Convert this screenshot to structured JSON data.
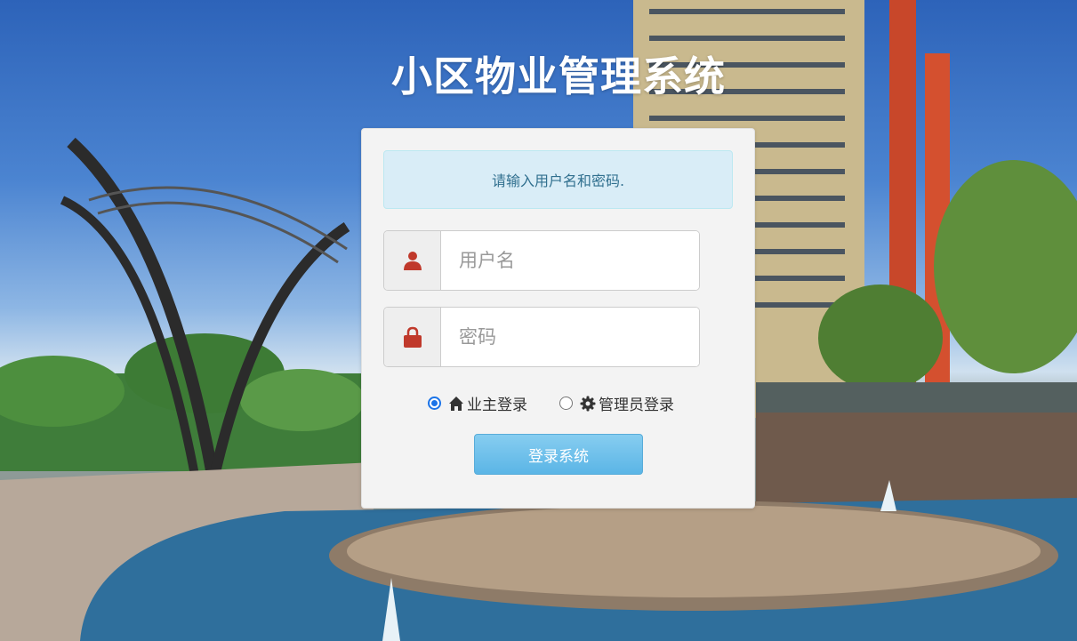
{
  "page": {
    "title": "小区物业管理系统"
  },
  "login": {
    "alert_text": "请输入用户名和密码.",
    "username_placeholder": "用户名",
    "password_placeholder": "密码",
    "roles": [
      {
        "label": "业主登录",
        "icon": "home-icon",
        "checked": true
      },
      {
        "label": "管理员登录",
        "icon": "gear-icon",
        "checked": false
      }
    ],
    "submit_label": "登录系统"
  },
  "colors": {
    "alert_bg": "#d9edf7",
    "alert_text": "#31708f",
    "icon_red": "#c0392b",
    "button_blue": "#5bb5e6",
    "radio_blue": "#1a73e8"
  },
  "icons": [
    "user-icon",
    "lock-icon",
    "home-icon",
    "gear-icon"
  ]
}
